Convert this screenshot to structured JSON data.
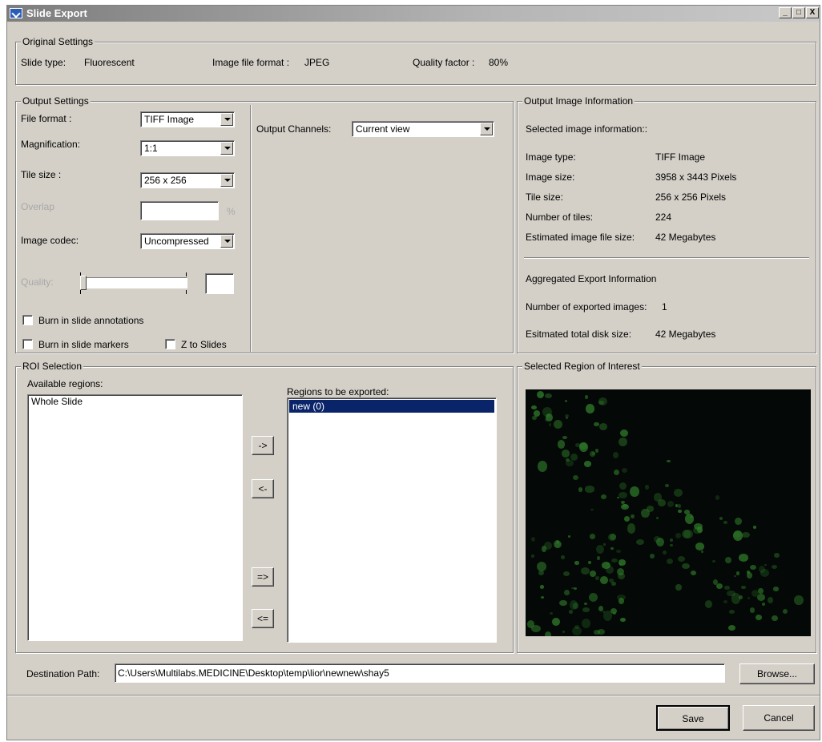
{
  "window": {
    "title": "Slide Export",
    "controls": {
      "minimize": "_",
      "maximize": "□",
      "close": "X"
    }
  },
  "original_settings": {
    "group_label": "Original Settings",
    "slide_type_label": "Slide type:",
    "slide_type_value": "Fluorescent",
    "image_format_label": "Image file format :",
    "image_format_value": "JPEG",
    "quality_label": "Quality factor :",
    "quality_value": "80%"
  },
  "output_settings": {
    "group_label": "Output Settings",
    "file_format_label": "File format :",
    "file_format_value": "TIFF Image",
    "magnification_label": "Magnification:",
    "magnification_value": "1:1",
    "tile_size_label": "Tile size :",
    "tile_size_value": "256 x 256",
    "overlap_label": "Overlap",
    "overlap_unit": "%",
    "image_codec_label": "Image codec:",
    "image_codec_value": "Uncompressed",
    "quality_label": "Quality:",
    "burn_annotations_label": "Burn in slide annotations",
    "burn_markers_label": "Burn in slide markers",
    "z_to_slides_label": "Z to Slides",
    "output_channels_label": "Output Channels:",
    "output_channels_value": "Current view"
  },
  "output_info": {
    "group_label": "Output Image Information",
    "heading": "Selected image information::",
    "rows": [
      {
        "label": "Image type:",
        "value": "TIFF Image"
      },
      {
        "label": "Image size:",
        "value": "3958 x 3443 Pixels"
      },
      {
        "label": "Tile size:",
        "value": "256 x 256 Pixels"
      },
      {
        "label": "Number of tiles:",
        "value": "224"
      },
      {
        "label": "Estimated image file size:",
        "value": "42 Megabytes"
      }
    ],
    "aggregated_heading": "Aggregated Export Information",
    "exported_images_label": "Number of exported images:",
    "exported_images_value": "1",
    "total_disk_label": "Esitmated total disk size:",
    "total_disk_value": "42 Megabytes"
  },
  "roi_selection": {
    "group_label": "ROI Selection",
    "available_label": "Available regions:",
    "available_items": [
      "Whole Slide"
    ],
    "export_label": "Regions to be exported:",
    "export_items": [
      "new (0)"
    ],
    "buttons": {
      "add": "->",
      "remove": "<-",
      "add_all": "=>",
      "remove_all": "<="
    }
  },
  "selected_roi": {
    "group_label": "Selected Region of Interest"
  },
  "destination": {
    "label": "Destination Path:",
    "path": "C:\\Users\\Multilabs.MEDICINE\\Desktop\\temp\\lior\\newnew\\shay5",
    "browse_label": "Browse..."
  },
  "footer": {
    "save_label": "Save",
    "cancel_label": "Cancel"
  },
  "colors": {
    "dialog_bg": "#d4d0c8",
    "selection": "#0a246a",
    "preview_bg": "#040806",
    "fluorescence": "#2f7a2a"
  }
}
